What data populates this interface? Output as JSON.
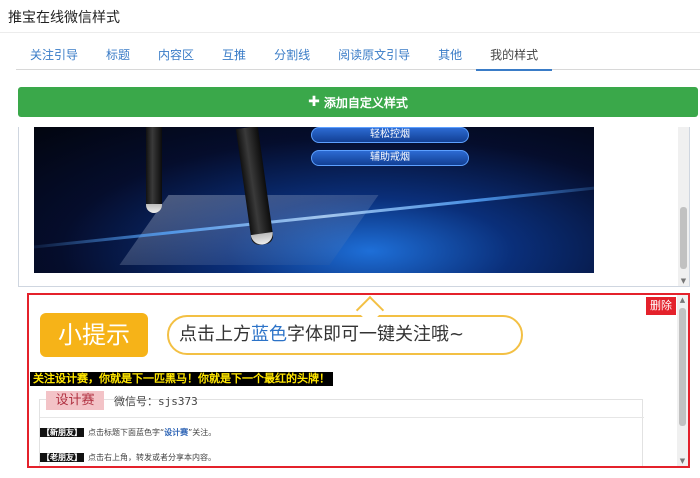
{
  "app": {
    "title": "推宝在线微信样式"
  },
  "tabs": [
    {
      "label": "关注引导"
    },
    {
      "label": "标题"
    },
    {
      "label": "内容区"
    },
    {
      "label": "互推"
    },
    {
      "label": "分割线"
    },
    {
      "label": "阅读原文引导"
    },
    {
      "label": "其他"
    },
    {
      "label": "我的样式",
      "active": true
    }
  ],
  "toolbar": {
    "add_label": "添加自定义样式"
  },
  "banner": {
    "pill1": "轻松控烟",
    "pill2": "辅助戒烟"
  },
  "selected_style": {
    "delete_label": "删除",
    "hint_badge": "小提示",
    "bubble_pre": "点击上方",
    "bubble_blue": "蓝色",
    "bubble_post": "字体即可一键关注哦~",
    "marquee": "关注设计赛，你就是下一匹黑马！你就是下一个最红的头牌！",
    "card_tag": "设计赛",
    "wechat_label": "微信号：",
    "wechat_id": "sjs373",
    "note1_label": "【新朋友】",
    "note1_pre": "点击标题下面蓝色字“",
    "note1_link": "设计赛",
    "note1_post": "”关注。",
    "note2_label": "【老朋友】",
    "note2_text": "点击右上角，转发或者分享本内容。"
  },
  "colors": {
    "accent": "#3a7cc7",
    "add_button": "#3aa84a",
    "selected_border": "#e4212b",
    "badge": "#f6b318"
  }
}
